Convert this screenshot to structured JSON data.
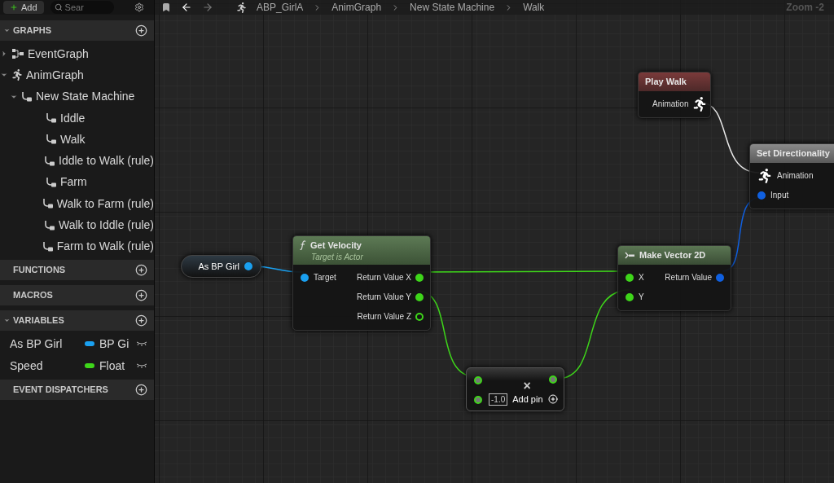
{
  "sidebar": {
    "add_button": "Add",
    "search": {
      "placeholder": "Sear"
    },
    "sections": [
      {
        "title": "GRAPHS",
        "expanded": true,
        "tree": [
          {
            "label": "EventGraph",
            "kind": "event_graph",
            "expanded": false
          },
          {
            "label": "AnimGraph",
            "kind": "anim_graph",
            "expanded": true,
            "children": [
              {
                "label": "New State Machine",
                "kind": "state_machine",
                "expanded": true,
                "children": [
                  {
                    "label": "Iddle",
                    "kind": "state"
                  },
                  {
                    "label": "Walk",
                    "kind": "state"
                  },
                  {
                    "label": "Iddle to Walk (rule)",
                    "kind": "state"
                  },
                  {
                    "label": "Farm",
                    "kind": "state"
                  },
                  {
                    "label": "Walk to Farm (rule)",
                    "kind": "state"
                  },
                  {
                    "label": "Walk to Iddle (rule)",
                    "kind": "state"
                  },
                  {
                    "label": "Farm to Walk (rule)",
                    "kind": "state"
                  }
                ]
              }
            ]
          }
        ]
      },
      {
        "title": "FUNCTIONS",
        "expanded": false
      },
      {
        "title": "MACROS",
        "expanded": false
      },
      {
        "title": "VARIABLES",
        "expanded": true,
        "variables": [
          {
            "name": "As BP Girl",
            "type": "BP Gi",
            "color": "#1aa0f0"
          },
          {
            "name": "Speed",
            "type": "Float",
            "color": "#3ed61a"
          }
        ]
      },
      {
        "title": "EVENT DISPATCHERS",
        "expanded": false
      }
    ]
  },
  "graph_toolbar": {
    "breadcrumbs": [
      "ABP_GirlA",
      "AnimGraph",
      "New State Machine",
      "Walk"
    ],
    "zoom": "Zoom -2"
  },
  "nodes": [
    {
      "kind": "variable",
      "title": "As BP Girl",
      "outputs": [
        {
          "kind": "data",
          "color": "#1aa0f0",
          "connected": true
        }
      ]
    },
    {
      "kind": "function",
      "title": "Get Velocity",
      "subtitle": "Target is Actor",
      "inputs": [
        {
          "kind": "data",
          "label": "Target",
          "color": "#1aa0f0",
          "connected": true
        }
      ],
      "outputs": [
        {
          "kind": "data",
          "label": "Return Value X",
          "color": "#3ed61a",
          "connected": true
        },
        {
          "kind": "data",
          "label": "Return Value Y",
          "color": "#3ed61a",
          "connected": true
        },
        {
          "kind": "data",
          "label": "Return Value Z",
          "color": "#3ed61a",
          "connected": false
        }
      ]
    },
    {
      "kind": "animation",
      "title": "Play Walk",
      "outputs": [
        {
          "kind": "anim",
          "label": "Animation"
        }
      ]
    },
    {
      "kind": "blend",
      "title": "Set Directionality",
      "inputs": [
        {
          "kind": "anim",
          "label": "Animation"
        },
        {
          "kind": "data",
          "label": "Input",
          "color": "#1060e0",
          "connected": true
        }
      ]
    },
    {
      "kind": "make",
      "title": "Make Vector 2D",
      "inputs": [
        {
          "kind": "data",
          "label": "X",
          "color": "#3ed61a",
          "connected": true
        },
        {
          "kind": "data",
          "label": "Y",
          "color": "#3ed61a",
          "connected": true
        }
      ],
      "outputs": [
        {
          "kind": "data",
          "label": "Return Value",
          "color": "#1060e0",
          "connected": true
        }
      ]
    },
    {
      "kind": "math",
      "operator": "×",
      "value": "-1.0",
      "add_pin": "Add pin"
    }
  ]
}
